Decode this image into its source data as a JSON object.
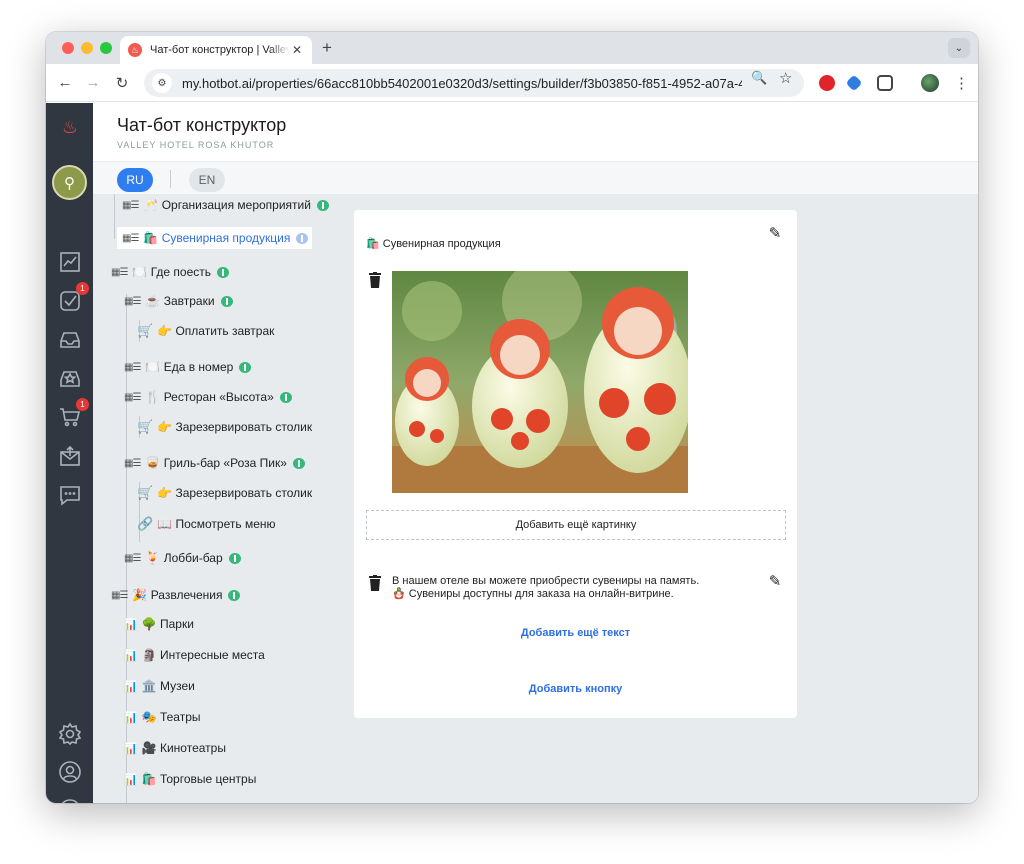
{
  "browser": {
    "tab_title": "Чат-бот конструктор | Valley",
    "tab_close": "✕",
    "new_tab": "+",
    "url": "my.hotbot.ai/properties/66acc810bb5402001e0320d3/settings/builder/f3b03850-f851-4952-a07a-4..."
  },
  "header": {
    "title": "Чат-бот конструктор",
    "subtitle": "VALLEY HOTEL ROSA KHUTOR"
  },
  "languages": {
    "active": "RU",
    "other": "EN"
  },
  "sidebar": {
    "badges": {
      "tasks": "1",
      "orders": "1"
    }
  },
  "tree": {
    "items": [
      {
        "label": "🥂 Организация мероприятий",
        "icon": "▦☰"
      },
      {
        "label": "🛍️ Сувенирная продукция",
        "icon": "▦☰"
      },
      {
        "label": "🍽️ Где поесть",
        "icon": "▦☰"
      },
      {
        "label": "☕ Завтраки",
        "icon": "▦☰"
      },
      {
        "label": "👉 Оплатить завтрак",
        "icon": "🛒"
      },
      {
        "label": "🍽️ Еда в номер",
        "icon": "▦☰"
      },
      {
        "label": "🍴 Ресторан «Высота»",
        "icon": "▦☰"
      },
      {
        "label": "👉 Зарезервировать столик",
        "icon": "🛒"
      },
      {
        "label": "🥃 Гриль-бар «Роза Пик»",
        "icon": "▦☰"
      },
      {
        "label": "👉 Зарезервировать столик",
        "icon": "🛒"
      },
      {
        "label": "📖 Посмотреть меню",
        "icon": "🔗"
      },
      {
        "label": "🍹 Лобби-бар",
        "icon": "▦☰"
      },
      {
        "label": "🎉 Развлечения",
        "icon": "▦☰"
      },
      {
        "label": "🌳 Парки",
        "icon": "📊"
      },
      {
        "label": "🗿 Интересные места",
        "icon": "📊"
      },
      {
        "label": "🏛️ Музеи",
        "icon": "📊"
      },
      {
        "label": "🎭 Театры",
        "icon": "📊"
      },
      {
        "label": "🎥 Кинотеатры",
        "icon": "📊"
      },
      {
        "label": "🛍️ Торговые центры",
        "icon": "📊"
      }
    ]
  },
  "card": {
    "heading": "🛍️ Сувенирная продукция",
    "add_image": "Добавить ещё картинку",
    "text_line1": "В нашем отеле вы можете приобрести сувениры на память.",
    "text_line2": "🪆 Сувениры доступны для заказа на онлайн-витрине.",
    "add_text": "Добавить ещё текст",
    "add_button": "Добавить кнопку"
  },
  "colors": {
    "accent": "#2f7ef0",
    "rail": "#313740",
    "brand_red": "#ef4b45",
    "brain_green": "#35b87a"
  },
  "icons": {
    "rail": [
      "flame-icon",
      "analytics-icon",
      "tasks-icon",
      "inbox-icon",
      "star-inbox-icon",
      "cart-icon",
      "mail-icon",
      "chat-icon",
      "settings-icon",
      "user-icon",
      "help-icon"
    ],
    "card": [
      "edit-icon",
      "trash-icon"
    ]
  }
}
